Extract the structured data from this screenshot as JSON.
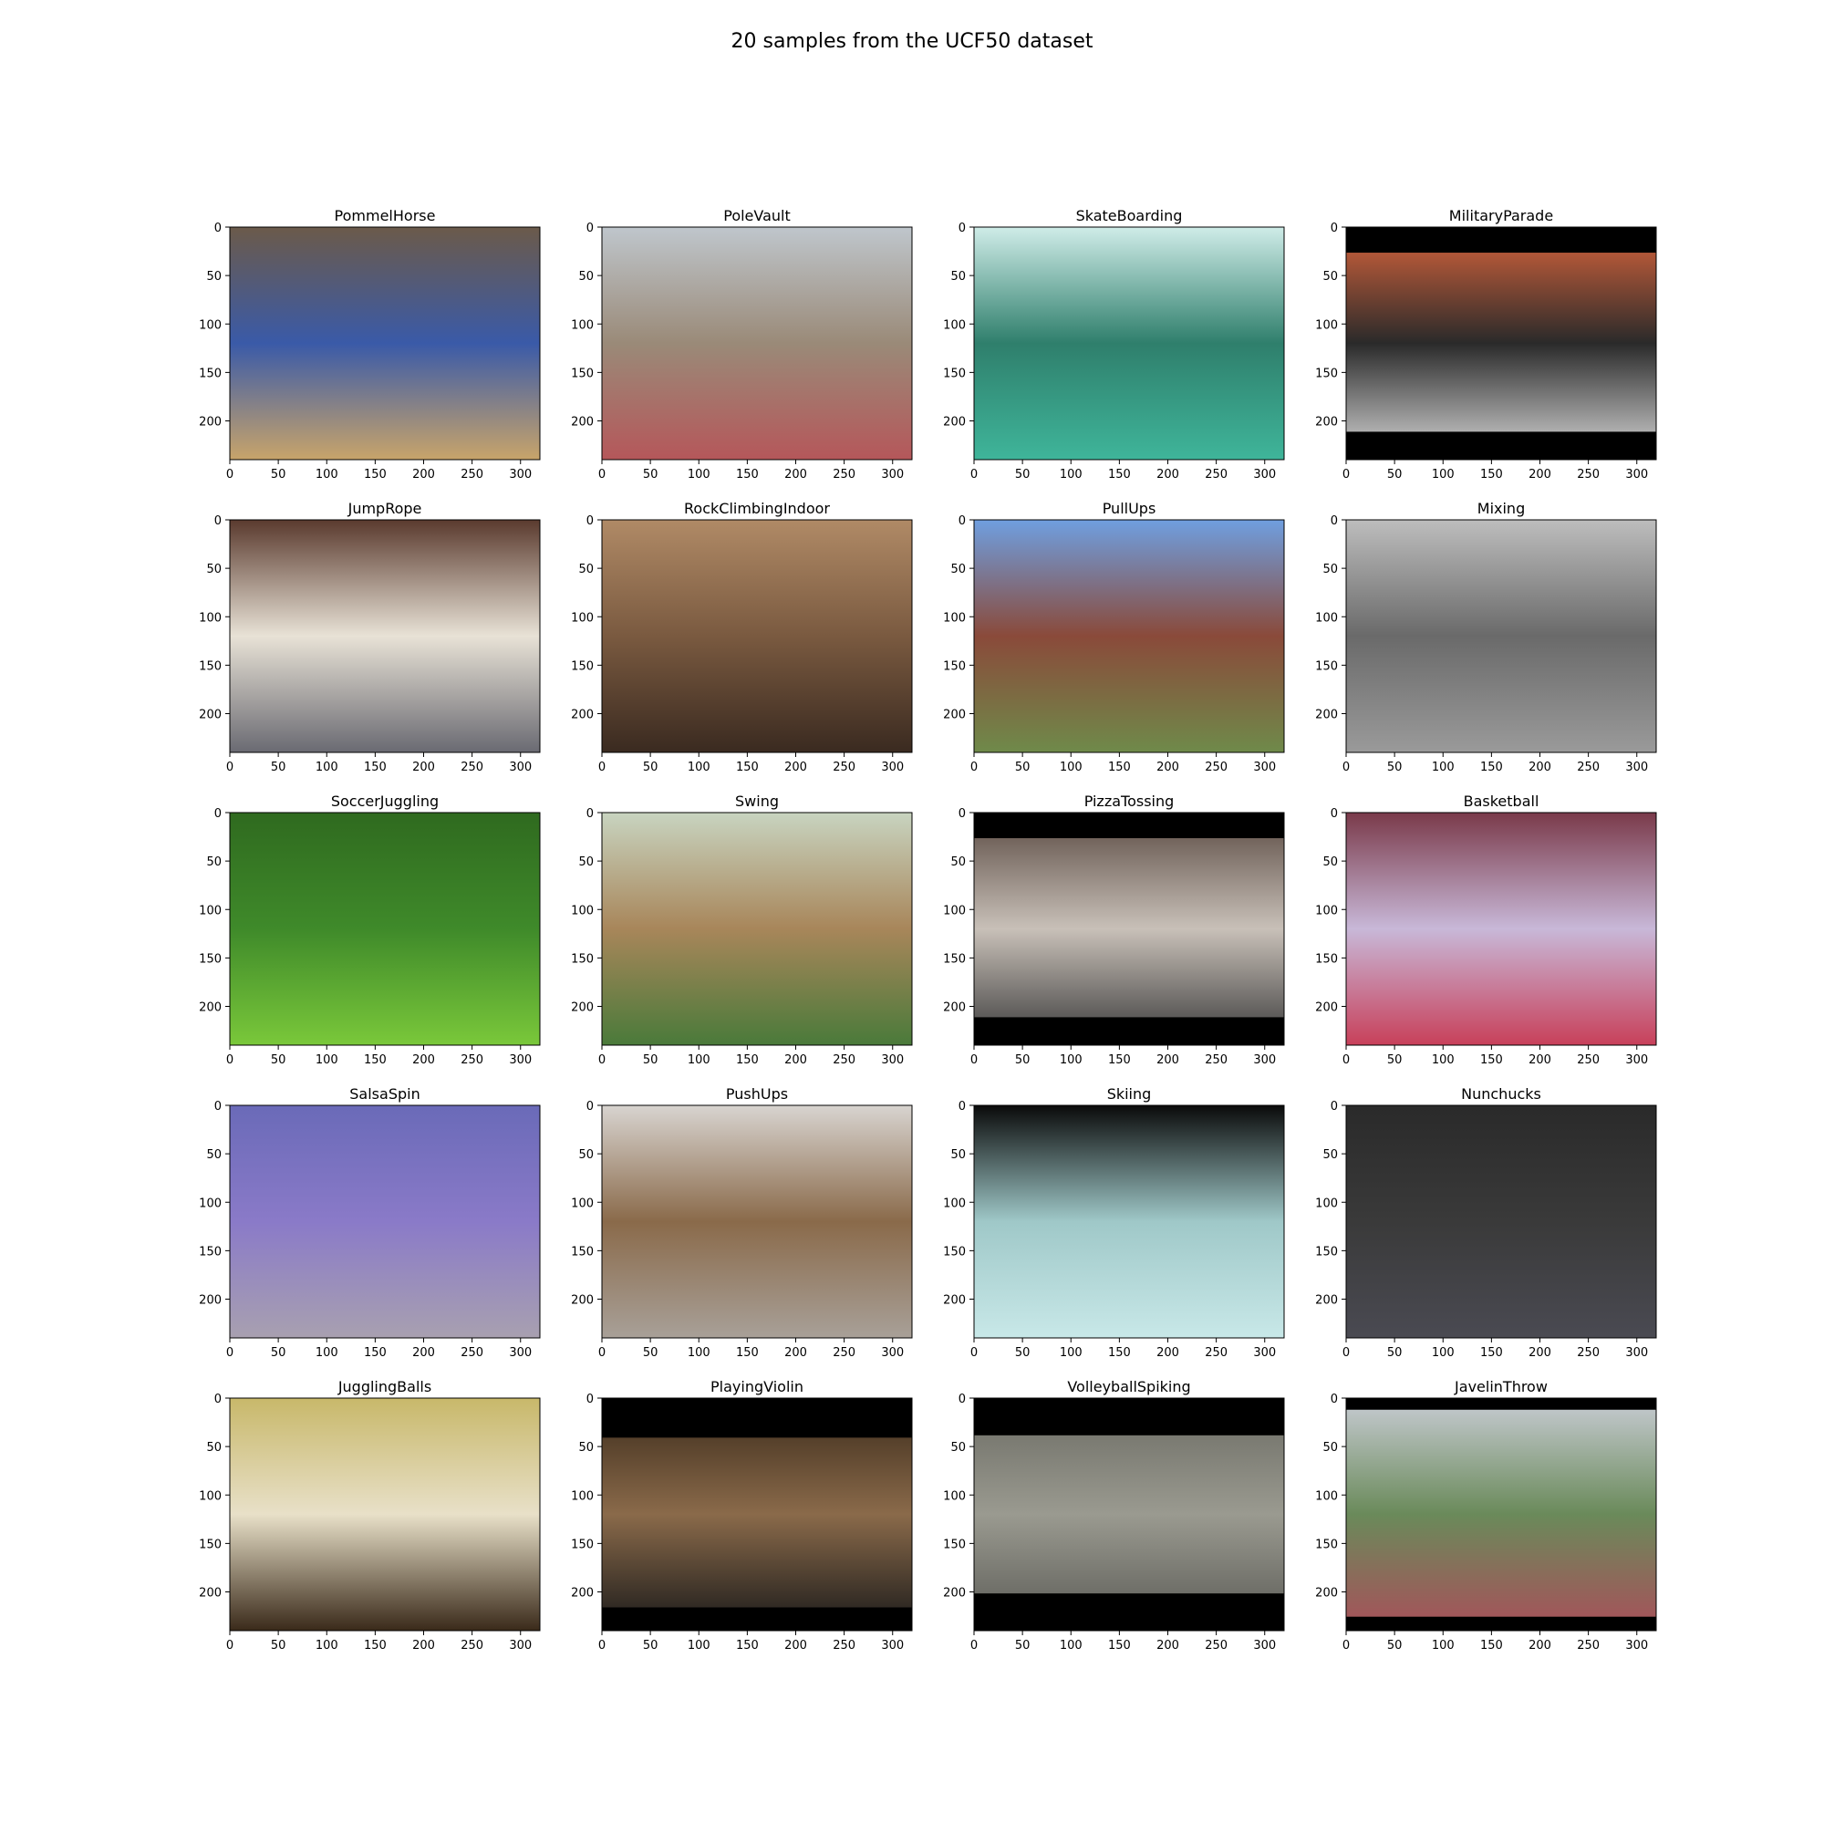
{
  "figure": {
    "suptitle": "20 samples from the UCF50 dataset"
  },
  "chart_data": {
    "type": "image_grid",
    "rows": 5,
    "cols": 4,
    "panel_axes": {
      "xlim": [
        0,
        320
      ],
      "ylim": [
        240,
        0
      ],
      "xticks": [
        0,
        50,
        100,
        150,
        200,
        250,
        300
      ],
      "yticks": [
        0,
        50,
        100,
        150,
        200
      ],
      "grid": false
    },
    "panels": [
      {
        "title": "PommelHorse",
        "scene": [
          "#6b5a4a",
          "#3a5aa8",
          "#c8a46a"
        ],
        "letterbox": [
          0,
          0
        ]
      },
      {
        "title": "PoleVault",
        "scene": [
          "#bfc6cc",
          "#9a8a78",
          "#b5575a"
        ],
        "letterbox": [
          0,
          0
        ]
      },
      {
        "title": "SkateBoarding",
        "scene": [
          "#cfece8",
          "#2f7f6c",
          "#3fb59a"
        ],
        "letterbox": [
          0,
          0
        ]
      },
      {
        "title": "MilitaryParade",
        "scene": [
          "#d8643c",
          "#2a2a2a",
          "#d9d9d9"
        ],
        "letterbox": [
          0.11,
          0.12
        ]
      },
      {
        "title": "JumpRope",
        "scene": [
          "#5a3a2e",
          "#e8e2d6",
          "#6a6a72"
        ],
        "letterbox": [
          0,
          0
        ]
      },
      {
        "title": "RockClimbingIndoor",
        "scene": [
          "#b08a66",
          "#7a5a40",
          "#3a2a20"
        ],
        "letterbox": [
          0,
          0
        ]
      },
      {
        "title": "PullUps",
        "scene": [
          "#6f9fe0",
          "#8a4a3a",
          "#6f8a4a"
        ],
        "letterbox": [
          0,
          0
        ]
      },
      {
        "title": "Mixing",
        "scene": [
          "#bdbdbd",
          "#6a6a6a",
          "#9a9a9a"
        ],
        "letterbox": [
          0,
          0
        ]
      },
      {
        "title": "SoccerJuggling",
        "scene": [
          "#2f6a1f",
          "#3f8a2a",
          "#7ac83a"
        ],
        "letterbox": [
          0,
          0
        ]
      },
      {
        "title": "Swing",
        "scene": [
          "#c8d4c0",
          "#a8865a",
          "#4a7a3a"
        ],
        "letterbox": [
          0,
          0
        ]
      },
      {
        "title": "PizzaTossing",
        "scene": [
          "#5a4a42",
          "#c8c0b8",
          "#3a3a3a"
        ],
        "letterbox": [
          0.11,
          0.12
        ]
      },
      {
        "title": "Basketball",
        "scene": [
          "#7a3a4a",
          "#c8b8d8",
          "#c8405a"
        ],
        "letterbox": [
          0,
          0
        ]
      },
      {
        "title": "SalsaSpin",
        "scene": [
          "#6a6ab8",
          "#8a7ac8",
          "#a8a0b0"
        ],
        "letterbox": [
          0,
          0
        ]
      },
      {
        "title": "PushUps",
        "scene": [
          "#d8d4d0",
          "#8a6a4a",
          "#a8a098"
        ],
        "letterbox": [
          0,
          0
        ]
      },
      {
        "title": "Skiing",
        "scene": [
          "#0a0a0a",
          "#9fc8c8",
          "#c8e8e8"
        ],
        "letterbox": [
          0,
          0
        ]
      },
      {
        "title": "Nunchucks",
        "scene": [
          "#2a2a2a",
          "#3a3a3a",
          "#4a4a52"
        ],
        "letterbox": [
          0,
          0
        ]
      },
      {
        "title": "JugglingBalls",
        "scene": [
          "#c8b86a",
          "#e8e0c8",
          "#3a2a1a"
        ],
        "letterbox": [
          0,
          0
        ]
      },
      {
        "title": "PlayingViolin",
        "scene": [
          "#3a2a1a",
          "#8a6a4a",
          "#1a1a1a"
        ],
        "letterbox": [
          0.17,
          0.1
        ]
      },
      {
        "title": "VolleyballSpiking",
        "scene": [
          "#6a6a62",
          "#9a9a90",
          "#5a5a55"
        ],
        "letterbox": [
          0.16,
          0.16
        ]
      },
      {
        "title": "JavelinThrow",
        "scene": [
          "#c8ccd4",
          "#6a8a5a",
          "#a8505a"
        ],
        "letterbox": [
          0.05,
          0.06
        ]
      }
    ]
  }
}
